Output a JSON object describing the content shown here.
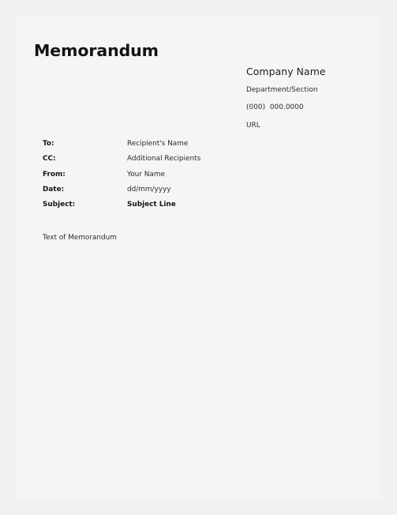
{
  "document": {
    "title": "Memorandum",
    "company": {
      "name": "Company Name",
      "department": "Department/Section",
      "phone": "(000)  000.0000",
      "url": "URL"
    },
    "fields": [
      {
        "label": "To:",
        "value": "Recipient's Name",
        "bold_value": false
      },
      {
        "label": "CC:",
        "value": "Additional Recipients",
        "bold_value": false
      },
      {
        "label": "From:",
        "value": "Your Name",
        "bold_value": false
      },
      {
        "label": "Date:",
        "value": "dd/mm/yyyy",
        "bold_value": false
      },
      {
        "label": "Subject:",
        "value": "Subject Line",
        "bold_value": true
      }
    ],
    "body": "Text of Memorandum"
  },
  "colors": {
    "page_background": "#f5f5f5",
    "canvas_background": "#f1f1f1",
    "heading_text": "#141414",
    "body_text": "#2b2b2b"
  }
}
